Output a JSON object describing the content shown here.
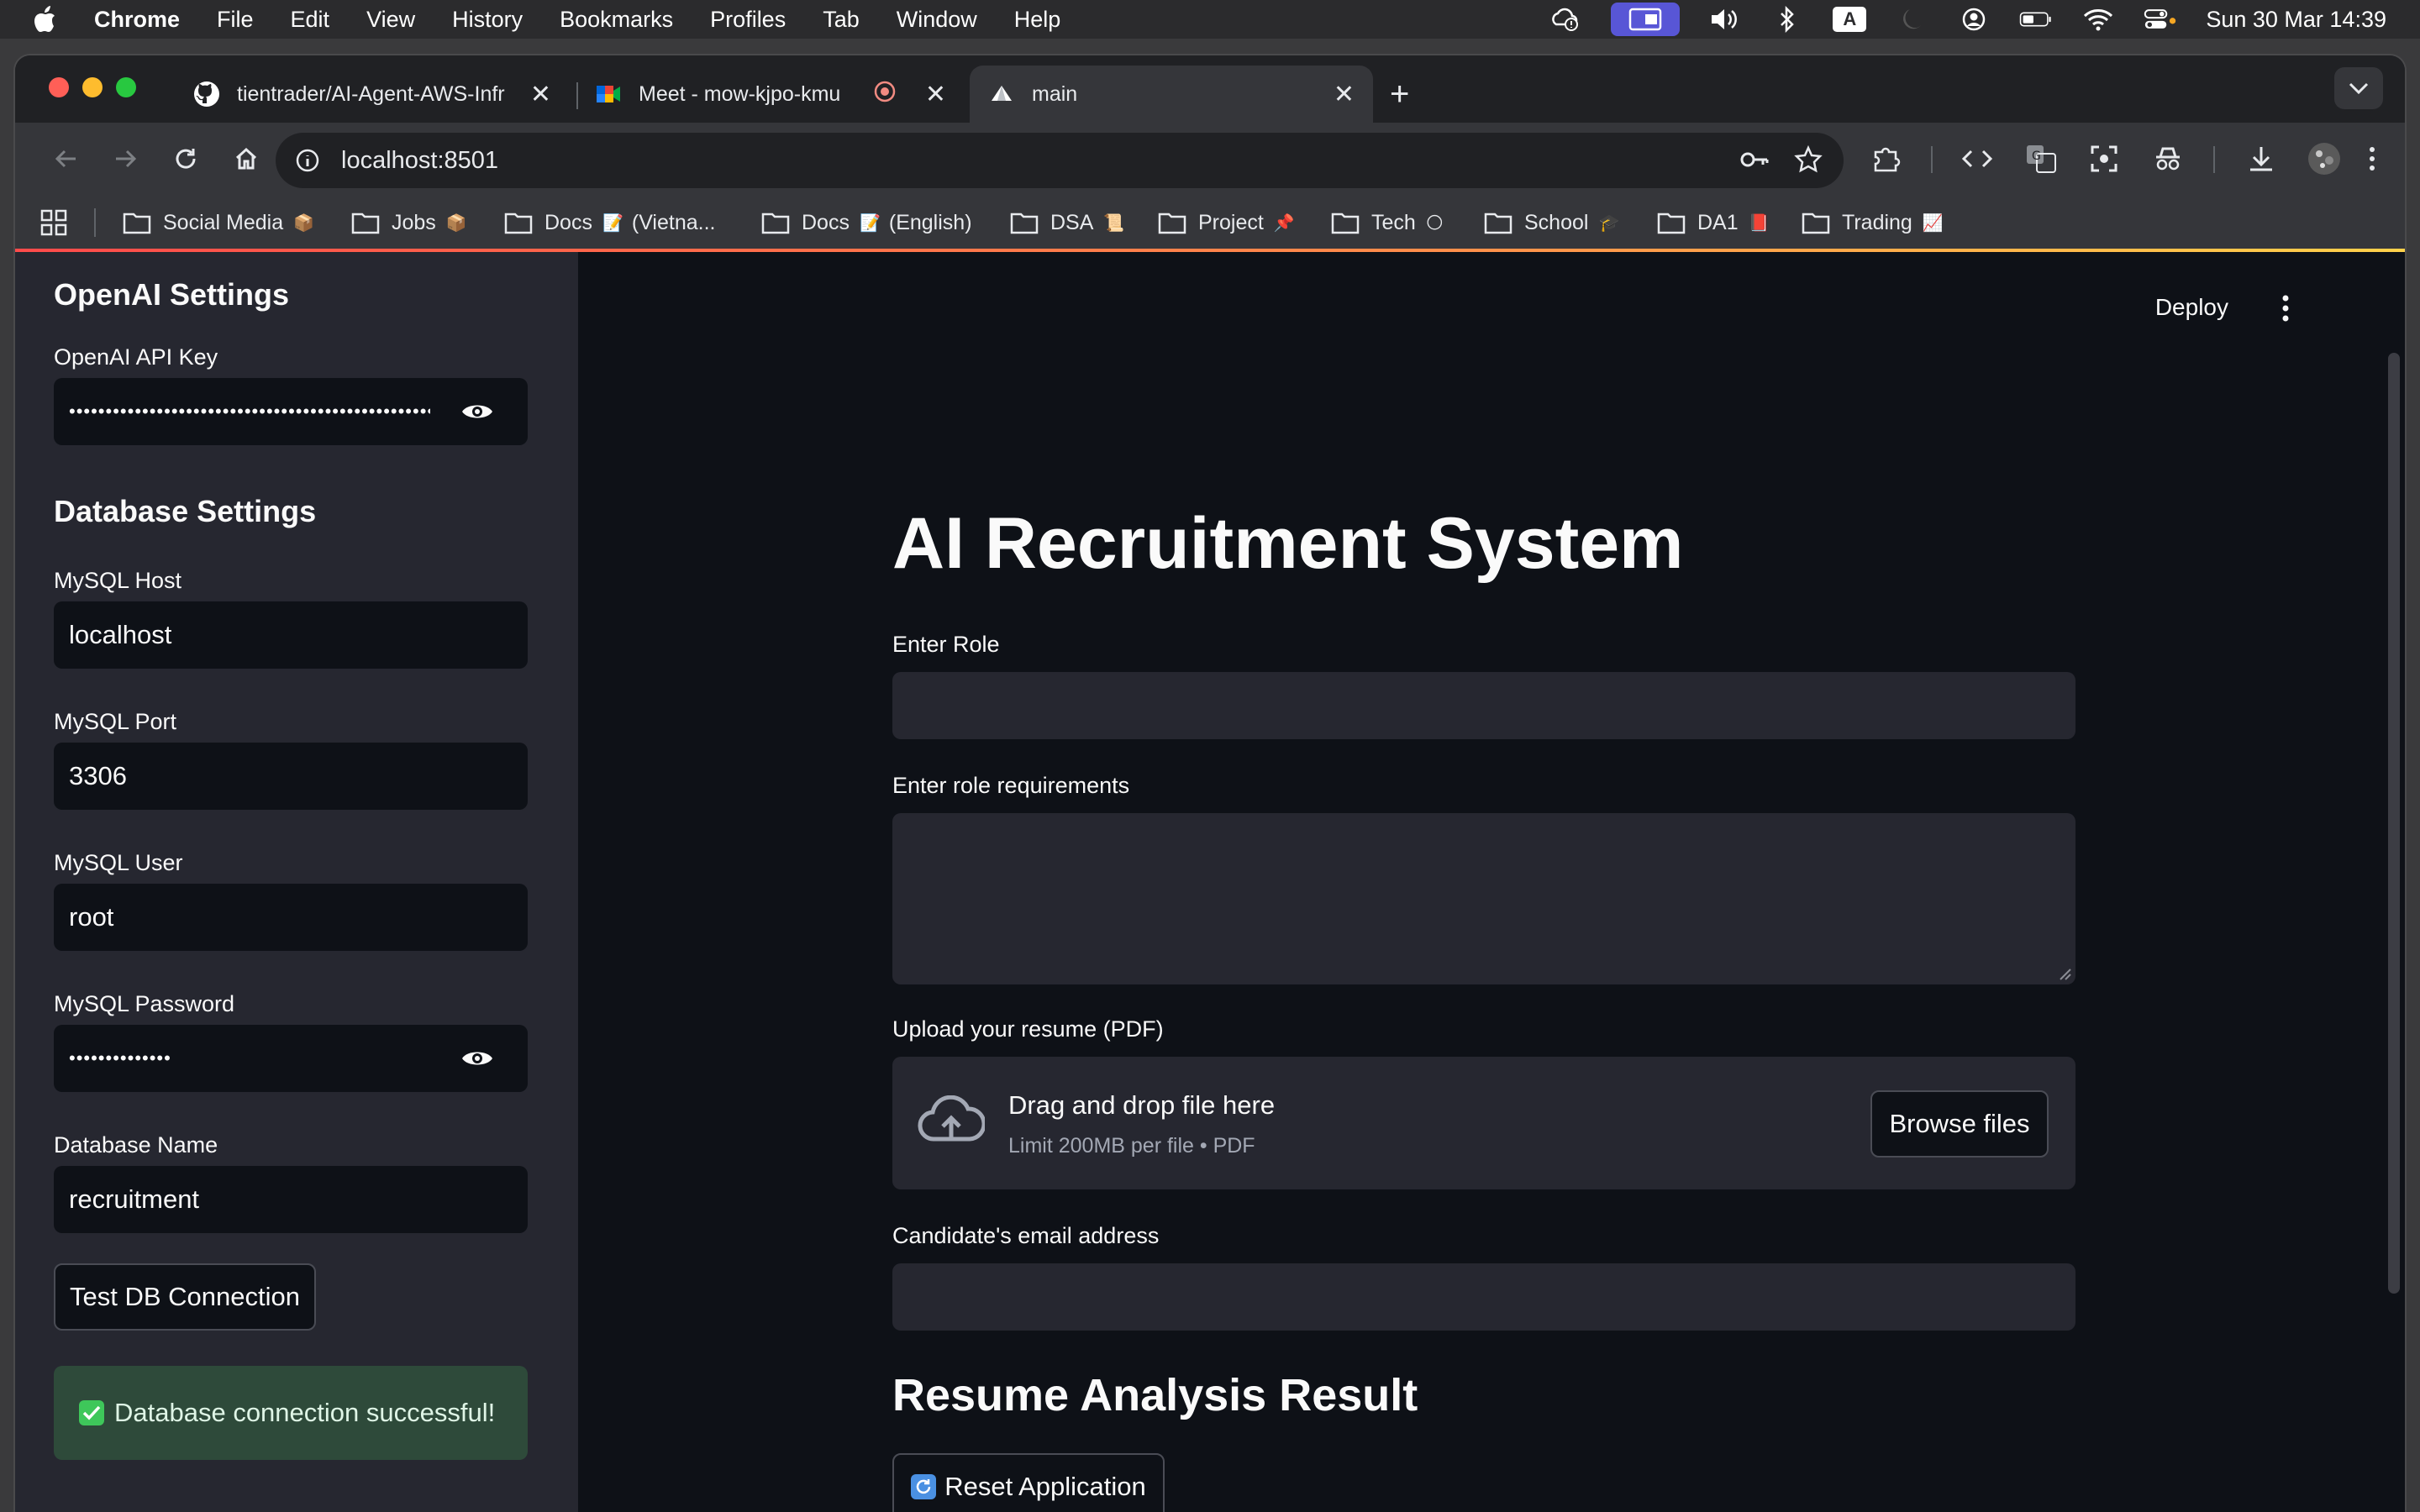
{
  "menubar": {
    "app_name": "Chrome",
    "items": [
      "File",
      "Edit",
      "View",
      "History",
      "Bookmarks",
      "Profiles",
      "Tab",
      "Window",
      "Help"
    ],
    "input_source": "A",
    "datetime": "Sun 30 Mar  14:39"
  },
  "browser": {
    "tabs": [
      {
        "title": "tientrader/AI-Agent-AWS-Infr",
        "favicon": "github-icon"
      },
      {
        "title": "Meet - mow-kjpo-kmu",
        "favicon": "google-meet-icon"
      },
      {
        "title": "main",
        "favicon": "streamlit-icon"
      }
    ],
    "url": "localhost:8501",
    "bookmarks": [
      {
        "label": "Social Media",
        "emoji": "📦"
      },
      {
        "label": "Jobs",
        "emoji": "📦"
      },
      {
        "label": "Docs",
        "emoji": "📝",
        "suffix": "(Vietna..."
      },
      {
        "label": "Docs",
        "emoji": "📝",
        "suffix": "(English)"
      },
      {
        "label": "DSA",
        "emoji": "📜"
      },
      {
        "label": "Project",
        "emoji": "📌"
      },
      {
        "label": "Tech",
        "emoji": "🌕"
      },
      {
        "label": "School",
        "emoji": "🎓"
      },
      {
        "label": "DA1",
        "emoji": "📕"
      },
      {
        "label": "Trading",
        "emoji": "📈"
      }
    ]
  },
  "sidebar": {
    "openai_heading": "OpenAI Settings",
    "api_key_label": "OpenAI API Key",
    "api_key_value": "••••••••••••••••••••••••••••••••••••••••••••••••••",
    "db_heading": "Database Settings",
    "host_label": "MySQL Host",
    "host_value": "localhost",
    "port_label": "MySQL Port",
    "port_value": "3306",
    "user_label": "MySQL User",
    "user_value": "root",
    "password_label": "MySQL Password",
    "password_value": "••••••••••••••",
    "dbname_label": "Database Name",
    "dbname_value": "recruitment",
    "test_button": "Test DB Connection",
    "success_message": "Database connection successful!"
  },
  "main": {
    "deploy_label": "Deploy",
    "title": "AI Recruitment System",
    "role_label": "Enter Role",
    "requirements_label": "Enter role requirements",
    "upload_label": "Upload your resume (PDF)",
    "dropzone_title": "Drag and drop file here",
    "dropzone_sub": "Limit 200MB per file • PDF",
    "browse_label": "Browse files",
    "email_label": "Candidate's email address",
    "result_heading": "Resume Analysis Result",
    "reset_label": "Reset Application"
  },
  "colors": {
    "sidebar_bg": "#262730",
    "main_bg": "#0e1117",
    "success_bg": "#2e4a3a",
    "accent": "#ff4b4b"
  }
}
